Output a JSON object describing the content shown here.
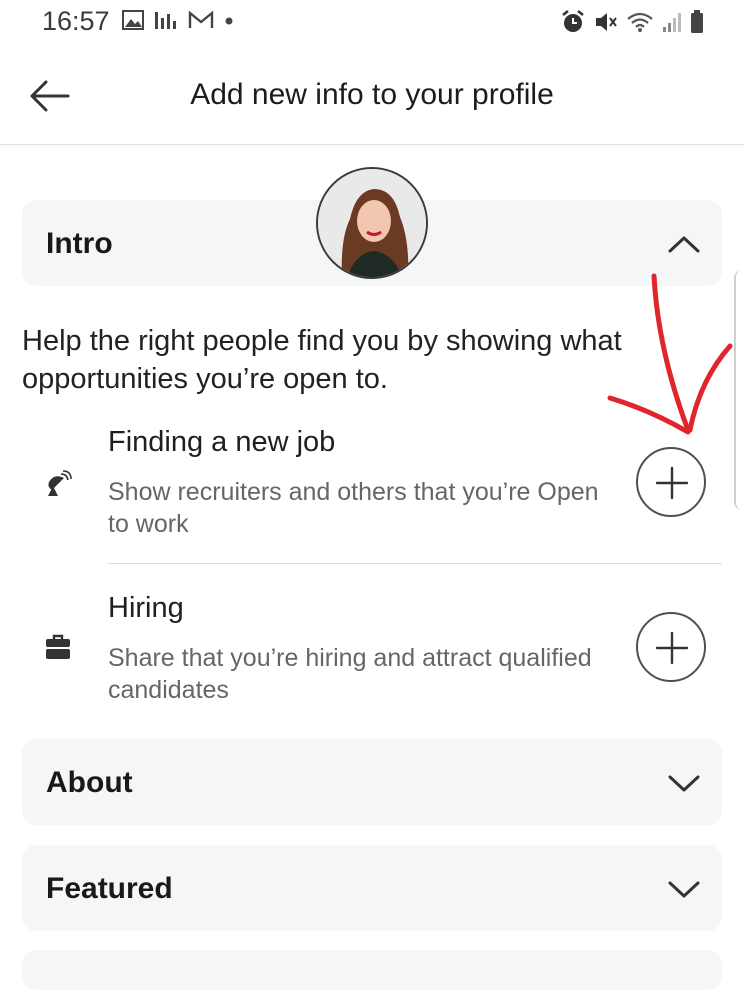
{
  "status_bar": {
    "time": "16:57"
  },
  "app_bar": {
    "title": "Add new info to your profile"
  },
  "intro": {
    "title": "Intro",
    "description": "Help the right people find you by showing what opportunities you’re open to.",
    "options": [
      {
        "title": "Finding a new job",
        "subtitle": "Show recruiters and others that you’re Open to work"
      },
      {
        "title": "Hiring",
        "subtitle": "Share that you’re hiring and attract qualified candidates"
      }
    ]
  },
  "about": {
    "title": "About"
  },
  "featured": {
    "title": "Featured"
  },
  "colors": {
    "annotation_arrow": "#e0262b",
    "card_bg": "#f5f6f8"
  }
}
